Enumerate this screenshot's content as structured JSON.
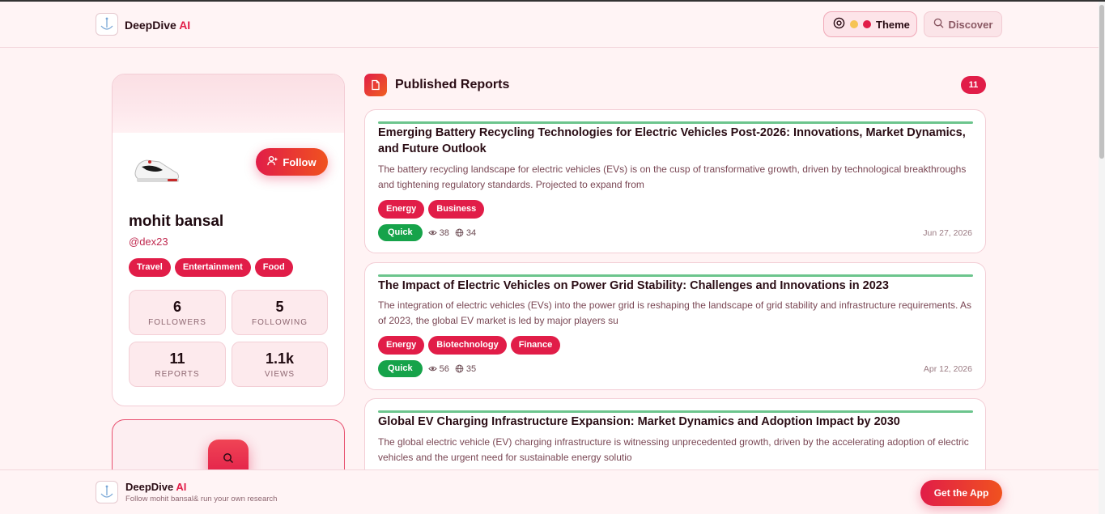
{
  "brand": {
    "name": "DeepDive",
    "ai": "AI"
  },
  "header": {
    "theme_label": "Theme",
    "discover_label": "Discover"
  },
  "profile": {
    "name": "mohit bansal",
    "handle": "@dex23",
    "follow_label": "Follow",
    "interests": [
      "Travel",
      "Entertainment",
      "Food"
    ],
    "stats": [
      {
        "value": "6",
        "label": "FOLLOWERS"
      },
      {
        "value": "5",
        "label": "FOLLOWING"
      },
      {
        "value": "11",
        "label": "REPORTS"
      },
      {
        "value": "1.1k",
        "label": "VIEWS"
      }
    ]
  },
  "reports_section": {
    "title": "Published Reports",
    "count": "11",
    "items": [
      {
        "title": "Emerging Battery Recycling Technologies for Electric Vehicles Post-2026: Innovations, Market Dynamics, and Future Outlook",
        "desc": "The battery recycling landscape for electric vehicles (EVs) is on the cusp of transformative growth, driven by technological breakthroughs and tightening regulatory standards. Projected to expand from",
        "tags": [
          "Energy",
          "Business"
        ],
        "type": "Quick",
        "views": "38",
        "reach": "34",
        "date": "Jun 27, 2026"
      },
      {
        "title": "The Impact of Electric Vehicles on Power Grid Stability: Challenges and Innovations in 2023",
        "desc": "The integration of electric vehicles (EVs) into the power grid is reshaping the landscape of grid stability and infrastructure requirements. As of 2023, the global EV market is led by major players su",
        "tags": [
          "Energy",
          "Biotechnology",
          "Finance"
        ],
        "type": "Quick",
        "views": "56",
        "reach": "35",
        "date": "Apr 12, 2026"
      },
      {
        "title": "Global EV Charging Infrastructure Expansion: Market Dynamics and Adoption Impact by 2030",
        "desc": "The global electric vehicle (EV) charging infrastructure is witnessing unprecedented growth, driven by the accelerating adoption of electric vehicles and the urgent need for sustainable energy solutio"
      }
    ]
  },
  "footer": {
    "subtitle": "Follow mohit bansal& run your own research",
    "cta": "Get the App"
  },
  "colors": {
    "accent": "#e11d48",
    "quick": "#16a34a",
    "bar": "#6cc58d"
  }
}
